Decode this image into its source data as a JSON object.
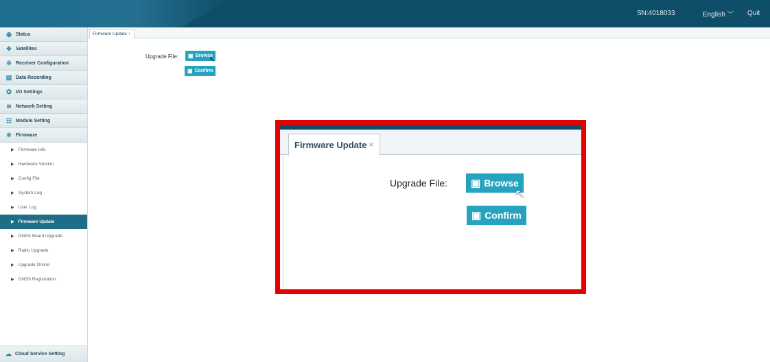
{
  "header": {
    "sn": "SN:4018033",
    "language": "English",
    "language_chevron": "chevron-down-icon",
    "quit": "Quit"
  },
  "sidebar": {
    "groups": [
      {
        "label": "Status",
        "icon": "eye-icon"
      },
      {
        "label": "Satellites",
        "icon": "satellite-icon"
      },
      {
        "label": "Receiver Configuration",
        "icon": "configuration-icon"
      },
      {
        "label": "Data Recording",
        "icon": "recording-icon"
      },
      {
        "label": "I/O Settings",
        "icon": "io-icon"
      },
      {
        "label": "Network Setting",
        "icon": "wifi-icon"
      },
      {
        "label": "Module Setting",
        "icon": "module-icon"
      },
      {
        "label": "Firmware",
        "icon": "firmware-icon"
      }
    ],
    "firmware_items": [
      "Firmware Info",
      "Hardware Version",
      "Config File",
      "System Log",
      "User Log",
      "Firmware Update",
      "GNSS Board Upgrade",
      "Radio Upgrade",
      "Upgrade Online",
      "GNSS Registration"
    ],
    "active_item": "Firmware Update",
    "cloud": "Cloud Service Setting"
  },
  "tab": {
    "label": "Firmware Update",
    "close": "×"
  },
  "form": {
    "upgrade_label": "Upgrade File:",
    "browse": "Browse",
    "confirm": "Confirm"
  },
  "colors": {
    "header": "#0f4e68",
    "accent": "#26a3bf",
    "active": "#1d6e86",
    "highlight_border": "#e60000"
  }
}
